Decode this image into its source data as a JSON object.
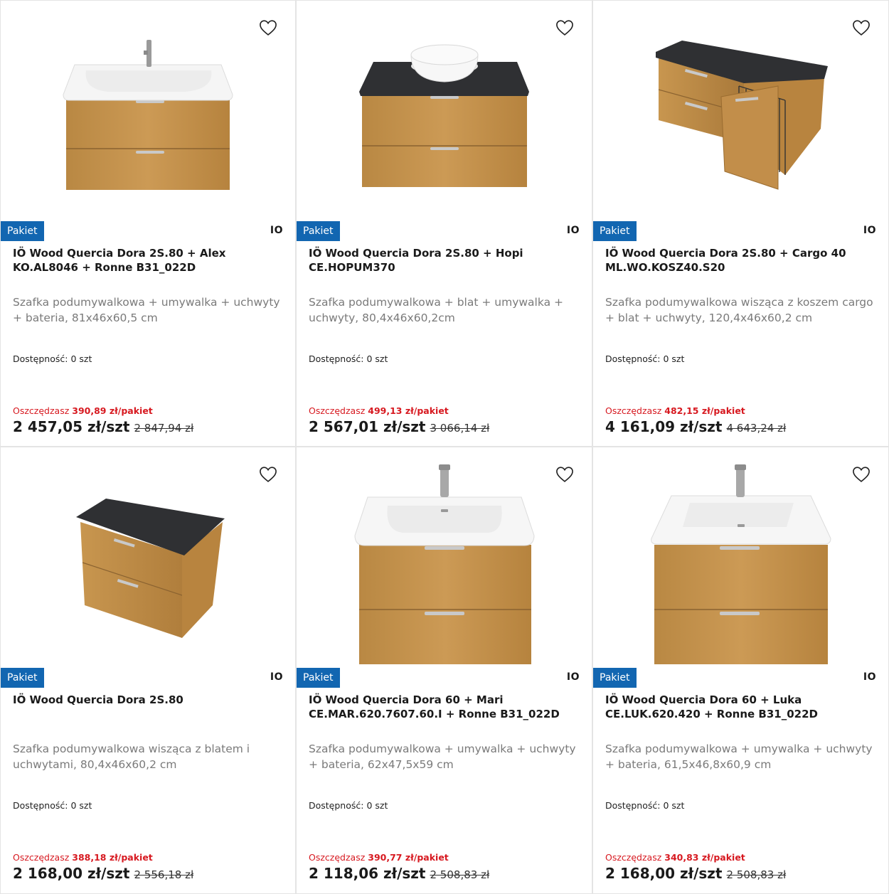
{
  "products": [
    {
      "badge": "Pakiet",
      "brand": "IO",
      "title": "IÖ Wood Quercia Dora 2S.80 + Alex KO.AL8046 + Ronne B31_022D",
      "description": "Szafka podumywalkowa + umywalka + uchwyty + bateria, 81x46x60,5 cm",
      "availability": "Dostępność: 0 szt",
      "save_label": "Oszczędzasz",
      "save_value": "390,89 zł/pakiet",
      "price": "2 457,05 zł/szt",
      "old_price": "2 847,94 zł"
    },
    {
      "badge": "Pakiet",
      "brand": "IO",
      "title": "IÖ Wood Quercia Dora 2S.80 + Hopi CE.HOPUM370",
      "description": "Szafka podumywalkowa + blat + umywalka + uchwyty, 80,4x46x60,2cm",
      "availability": "Dostępność: 0 szt",
      "save_label": "Oszczędzasz",
      "save_value": "499,13 zł/pakiet",
      "price": "2 567,01 zł/szt",
      "old_price": "3 066,14 zł"
    },
    {
      "badge": "Pakiet",
      "brand": "IO",
      "title": "IÖ Wood Quercia Dora 2S.80 + Cargo 40 ML.WO.KOSZ40.S20",
      "description": "Szafka podumywalkowa wisząca z koszem cargo + blat + uchwyty, 120,4x46x60,2 cm",
      "availability": "Dostępność: 0 szt",
      "save_label": "Oszczędzasz",
      "save_value": "482,15 zł/pakiet",
      "price": "4 161,09 zł/szt",
      "old_price": "4 643,24 zł"
    },
    {
      "badge": "Pakiet",
      "brand": "IO",
      "title": "IÖ Wood Quercia Dora 2S.80",
      "description": "Szafka podumywalkowa wisząca z blatem i uchwytami, 80,4x46x60,2 cm",
      "availability": "Dostępność: 0 szt",
      "save_label": "Oszczędzasz",
      "save_value": "388,18 zł/pakiet",
      "price": "2 168,00 zł/szt",
      "old_price": "2 556,18 zł"
    },
    {
      "badge": "Pakiet",
      "brand": "IO",
      "title": "IÖ Wood Quercia Dora 60 + Mari CE.MAR.620.7607.60.I + Ronne B31_022D",
      "description": "Szafka podumywalkowa + umywalka + uchwyty + bateria, 62x47,5x59 cm",
      "availability": "Dostępność: 0 szt",
      "save_label": "Oszczędzasz",
      "save_value": "390,77 zł/pakiet",
      "price": "2 118,06 zł/szt",
      "old_price": "2 508,83 zł"
    },
    {
      "badge": "Pakiet",
      "brand": "IO",
      "title": "IÖ Wood Quercia Dora 60 + Luka CE.LUK.620.420 + Ronne B31_022D",
      "description": "Szafka podumywalkowa + umywalka + uchwyty + bateria, 61,5x46,8x60,9 cm",
      "availability": "Dostępność: 0 szt",
      "save_label": "Oszczędzasz",
      "save_value": "340,83 zł/pakiet",
      "price": "2 168,00 zł/szt",
      "old_price": "2 508,83 zł"
    }
  ],
  "colors": {
    "badge": "#1266b1",
    "save": "#d71920",
    "oak": "#c8964f",
    "countertop": "#2f3033",
    "ceramic": "#ffffff"
  },
  "icons": {
    "wishlist": "heart-outline-icon"
  }
}
